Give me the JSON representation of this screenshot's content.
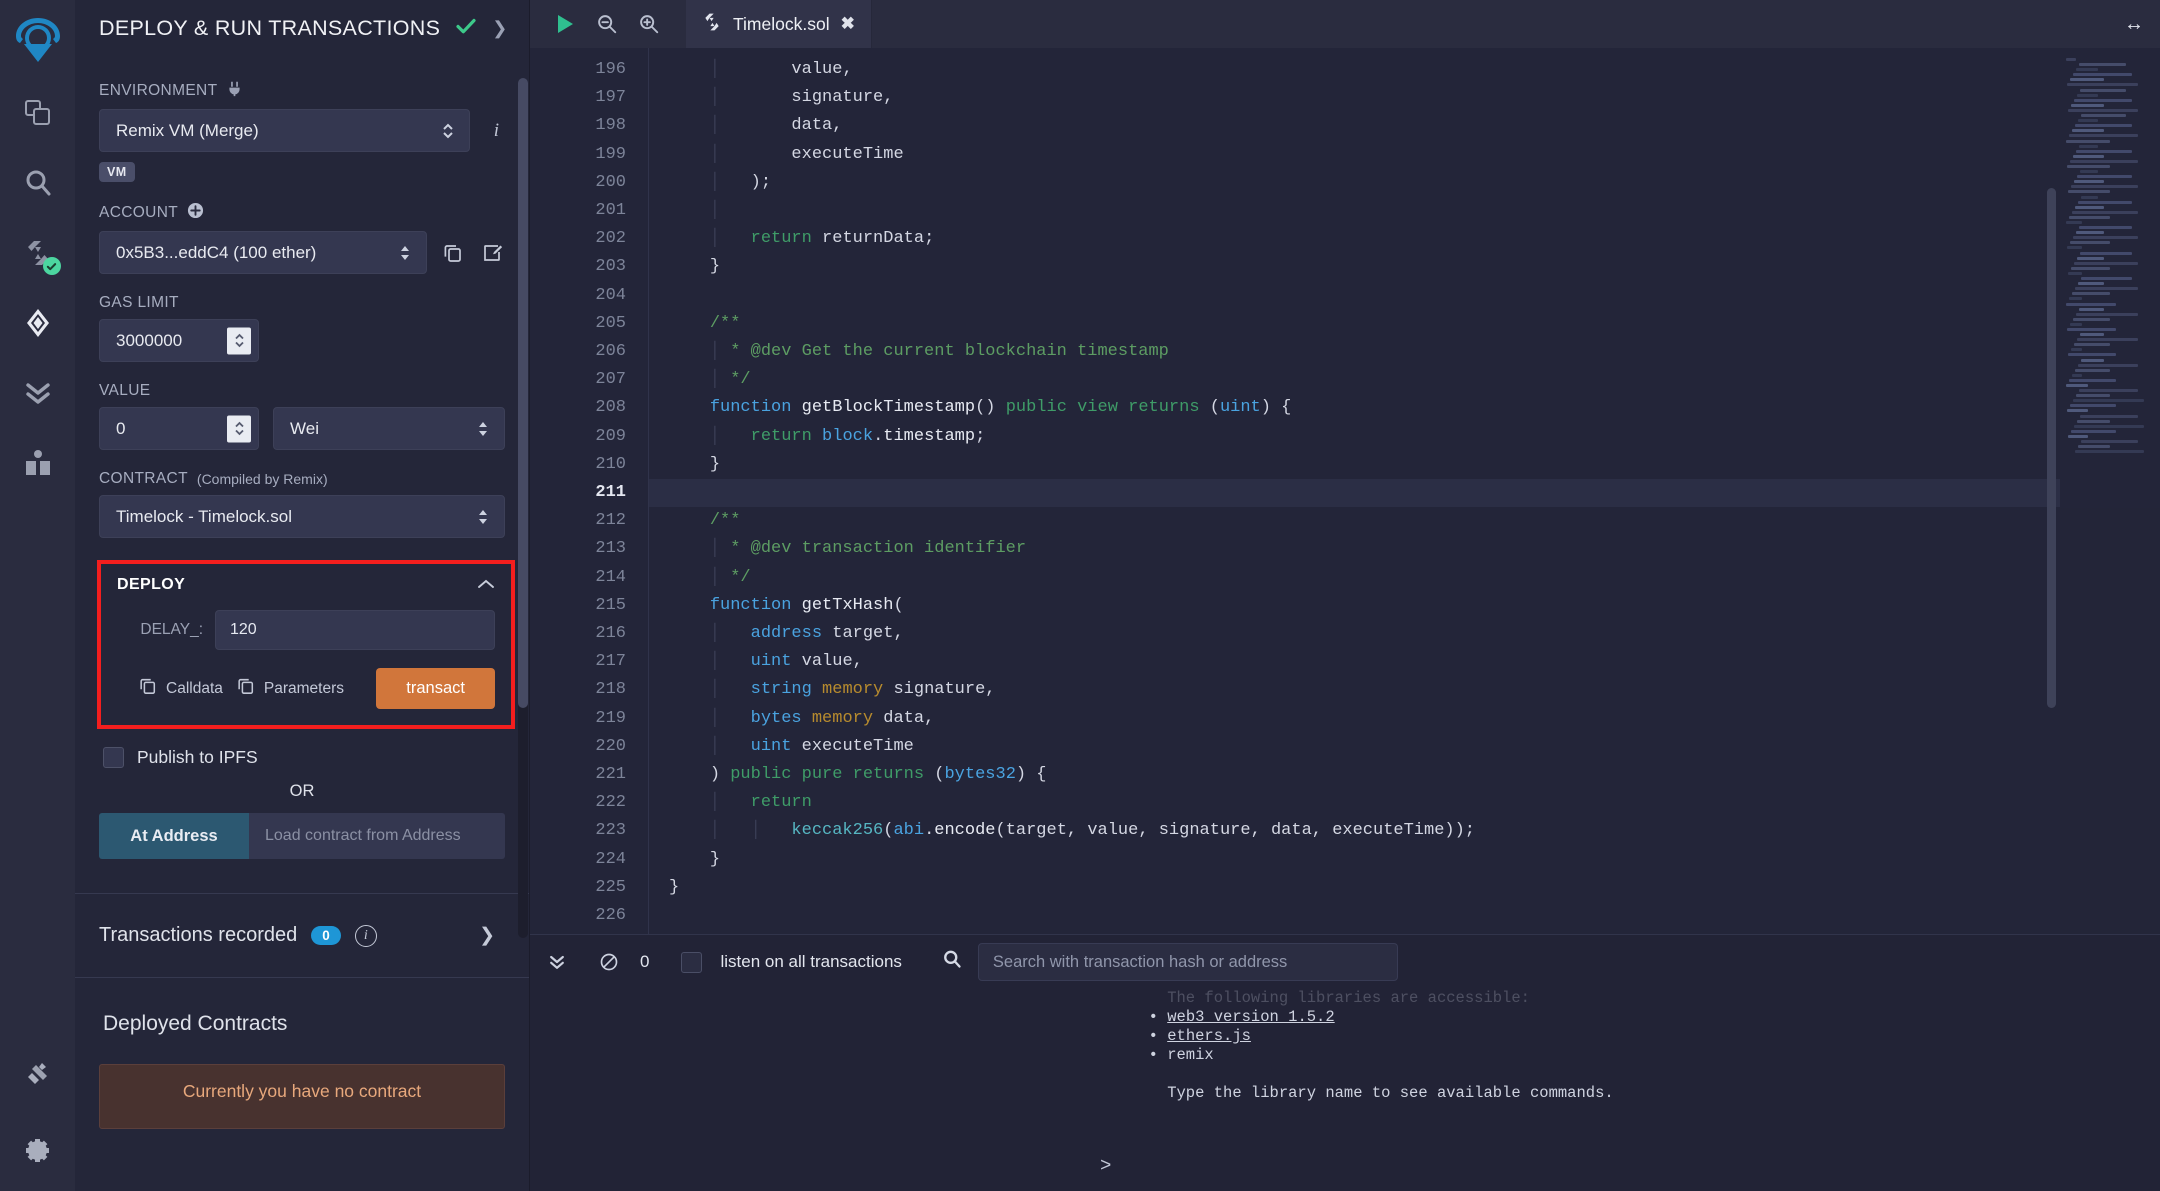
{
  "rail": {
    "logo_name": "remix-logo",
    "items": [
      {
        "name": "file-explorer-icon",
        "label": "File explorers"
      },
      {
        "name": "search-icon",
        "label": "Search in files"
      },
      {
        "name": "solidity-compiler-icon",
        "label": "Solidity compiler"
      },
      {
        "name": "deploy-run-icon",
        "label": "Deploy & run transactions"
      },
      {
        "name": "debugger-icon",
        "label": "Debugger"
      },
      {
        "name": "learneth-icon",
        "label": "LearnEth"
      }
    ],
    "bottom_items": [
      {
        "name": "plugin-manager-icon",
        "label": "Plugin manager"
      },
      {
        "name": "settings-gear-icon",
        "label": "Settings"
      }
    ]
  },
  "panel": {
    "title": "DEPLOY & RUN TRANSACTIONS",
    "environment": {
      "label": "ENVIRONMENT",
      "value": "Remix VM (Merge)",
      "chip": "VM"
    },
    "account": {
      "label": "ACCOUNT",
      "value": "0x5B3...eddC4 (100 ether)"
    },
    "gas_limit": {
      "label": "GAS LIMIT",
      "value": "3000000"
    },
    "value": {
      "label": "VALUE",
      "amount": "0",
      "unit": "Wei"
    },
    "contract": {
      "label": "CONTRACT",
      "sublabel": "(Compiled by Remix)",
      "value": "Timelock - Timelock.sol"
    },
    "deploy": {
      "title": "DEPLOY",
      "param_name": "DELAY_:",
      "param_value": "120",
      "calldata_label": "Calldata",
      "parameters_label": "Parameters",
      "transact_label": "transact",
      "accent_color": "#d1763b",
      "highlight_color": "#f41e1e"
    },
    "ipfs_label": "Publish to IPFS",
    "or_label": "OR",
    "at_address": {
      "button_label": "At Address",
      "placeholder": "Load contract from Address"
    },
    "transactions_recorded": {
      "label": "Transactions recorded",
      "count": "0"
    },
    "deployed_contracts": {
      "title": "Deployed Contracts",
      "empty_message": "Currently you have no contract"
    }
  },
  "toolbar": {
    "run_label": "run-script-icon",
    "zoom_out_label": "zoom-out-icon",
    "zoom_in_label": "zoom-in-icon",
    "tab_name": "Timelock.sol"
  },
  "editor": {
    "current_line": 211,
    "lines": [
      {
        "n": 196,
        "html": "<span class=\"ind\">    │       </span><span class=\"id\">value</span>,"
      },
      {
        "n": 197,
        "html": "<span class=\"ind\">    │       </span><span class=\"id\">signature</span>,"
      },
      {
        "n": 198,
        "html": "<span class=\"ind\">    │       </span><span class=\"id\">data</span>,"
      },
      {
        "n": 199,
        "html": "<span class=\"ind\">    │       </span><span class=\"id\">executeTime</span>"
      },
      {
        "n": 200,
        "html": "<span class=\"ind\">    │   </span>);"
      },
      {
        "n": 201,
        "html": "<span class=\"ind\">    │</span>"
      },
      {
        "n": 202,
        "html": "<span class=\"ind\">    │   </span><span class=\"kw2\">return</span> <span class=\"id\">returnData</span>;"
      },
      {
        "n": 203,
        "html": "<span class=\"ind\">    </span>}"
      },
      {
        "n": 204,
        "html": ""
      },
      {
        "n": 205,
        "html": "<span class=\"ind\">    </span><span class=\"cm\">/**</span>"
      },
      {
        "n": 206,
        "html": "<span class=\"ind\">    │</span><span class=\"cm\"> * @dev Get the current blockchain timestamp</span>"
      },
      {
        "n": 207,
        "html": "<span class=\"ind\">    │</span><span class=\"cm\"> */</span>"
      },
      {
        "n": 208,
        "html": "<span class=\"ind\">    </span><span class=\"kw\">function</span> <span class=\"fn\">getBlockTimestamp</span>() <span class=\"kw2\">public</span> <span class=\"kw2\">view</span> <span class=\"kw2\">returns</span> (<span class=\"ty\">uint</span>) {"
      },
      {
        "n": 209,
        "html": "<span class=\"ind\">    │   </span><span class=\"kw2\">return</span> <span class=\"ty\">block</span>.<span class=\"fn\">timestamp</span>;"
      },
      {
        "n": 210,
        "html": "<span class=\"ind\">    </span>}"
      },
      {
        "n": 211,
        "html": ""
      },
      {
        "n": 212,
        "html": "<span class=\"ind\">    </span><span class=\"cm\">/**</span>"
      },
      {
        "n": 213,
        "html": "<span class=\"ind\">    │</span><span class=\"cm\"> * @dev transaction identifier</span>"
      },
      {
        "n": 214,
        "html": "<span class=\"ind\">    │</span><span class=\"cm\"> */</span>"
      },
      {
        "n": 215,
        "html": "<span class=\"ind\">    </span><span class=\"kw\">function</span> <span class=\"fn\">getTxHash</span>("
      },
      {
        "n": 216,
        "html": "<span class=\"ind\">    │   </span><span class=\"ty\">address</span> <span class=\"id\">target</span>,"
      },
      {
        "n": 217,
        "html": "<span class=\"ind\">    │   </span><span class=\"ty\">uint</span> <span class=\"id\">value</span>,"
      },
      {
        "n": 218,
        "html": "<span class=\"ind\">    │   </span><span class=\"ty\">string</span> <span class=\"mem\">memory</span> <span class=\"id\">signature</span>,"
      },
      {
        "n": 219,
        "html": "<span class=\"ind\">    │   </span><span class=\"ty\">bytes</span> <span class=\"mem\">memory</span> <span class=\"id\">data</span>,"
      },
      {
        "n": 220,
        "html": "<span class=\"ind\">    │   </span><span class=\"ty\">uint</span> <span class=\"id\">executeTime</span>"
      },
      {
        "n": 221,
        "html": "<span class=\"ind\">    </span>) <span class=\"kw2\">public</span> <span class=\"kw2\">pure</span> <span class=\"kw2\">returns</span> (<span class=\"ty\">bytes32</span>) {"
      },
      {
        "n": 222,
        "html": "<span class=\"ind\">    │   </span><span class=\"kw2\">return</span>"
      },
      {
        "n": 223,
        "html": "<span class=\"ind\">    │   │   </span><span class=\"lit\">keccak256</span>(<span class=\"ty\">abi</span>.<span class=\"fn\">encode</span>(<span class=\"id\">target</span>, <span class=\"id\">value</span>, <span class=\"id\">signature</span>, <span class=\"id\">data</span>, <span class=\"id\">executeTime</span>));"
      },
      {
        "n": 224,
        "html": "<span class=\"ind\">    </span>}"
      },
      {
        "n": 225,
        "html": "}"
      },
      {
        "n": 226,
        "html": ""
      }
    ]
  },
  "terminal": {
    "pending_count": "0",
    "listen_label": "listen on all transactions",
    "search_placeholder": "Search with transaction hash or address",
    "output": "    The following libraries are accessible:\n  • web3 version 1.5.2\n  • ethers.js\n  • remix\n\n    Type the library name to see available commands.",
    "output_lines": [
      {
        "text": "The following libraries are accessible:",
        "style": "faded"
      },
      {
        "text": "web3 version 1.5.2",
        "style": "link"
      },
      {
        "text": "ethers.js",
        "style": "link"
      },
      {
        "text": "remix",
        "style": "plain"
      },
      {
        "text": "Type the library name to see available commands.",
        "style": "plain"
      }
    ],
    "prompt": ">"
  }
}
